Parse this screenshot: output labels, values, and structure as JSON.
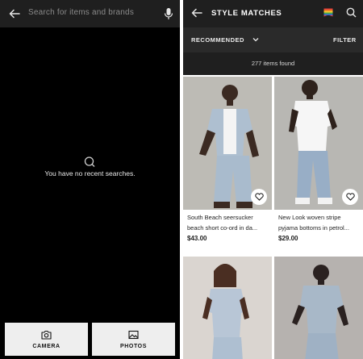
{
  "search_screen": {
    "search_placeholder": "Search for items and brands",
    "empty_message": "You have no recent searches.",
    "buttons": [
      {
        "label": "CAMERA",
        "icon": "camera-icon"
      },
      {
        "label": "PHOTOS",
        "icon": "image-icon"
      }
    ]
  },
  "results_screen": {
    "title": "STYLE MATCHES",
    "sort_label": "RECOMMENDED",
    "filter_label": "FILTER",
    "items_found": "277 items found",
    "products": [
      {
        "name": "South Beach seersucker beach short co-ord in da...",
        "price": "$43.00"
      },
      {
        "name": "New Look woven stripe pyjama bottoms in petrol...",
        "price": "$29.00"
      },
      {
        "name": "",
        "price": ""
      },
      {
        "name": "",
        "price": ""
      }
    ]
  },
  "colors": {
    "dark_bg": "#000000",
    "bar_bg": "#1f1f1f",
    "button_bg": "#eeeeee",
    "accent_text": "#ffffff"
  }
}
